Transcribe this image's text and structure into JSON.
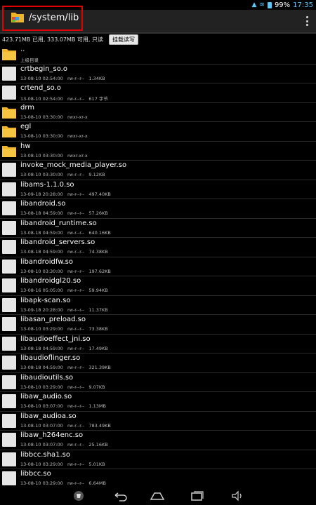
{
  "status": {
    "battery": "99%",
    "time": "17:35"
  },
  "header": {
    "path": "/system/lib"
  },
  "info": {
    "storage": "423.71MB 已用, 333.07MB 可用, 只读",
    "mount_button": "挂载读写"
  },
  "files": [
    {
      "type": "folder",
      "name": "..",
      "meta": "上级目录"
    },
    {
      "type": "file",
      "name": "crtbegin_so.o",
      "meta": "13-08-10 02:54:00   rw-r--r--   1.34KB"
    },
    {
      "type": "file",
      "name": "crtend_so.o",
      "meta": "13-08-10 02:54:00   rw-r--r--   617 字节"
    },
    {
      "type": "folder",
      "name": "drm",
      "meta": "13-08-10 03:30:00   rwxr-xr-x"
    },
    {
      "type": "folder",
      "name": "egl",
      "meta": "13-08-10 03:30:00   rwxr-xr-x"
    },
    {
      "type": "folder",
      "name": "hw",
      "meta": "13-08-10 03:30:00   rwxr-xr-x"
    },
    {
      "type": "file",
      "name": "invoke_mock_media_player.so",
      "meta": "13-08-10 03:30:00   rw-r--r--   9.12KB"
    },
    {
      "type": "file",
      "name": "libams-1.1.0.so",
      "meta": "13-09-18 20:28:00   rw-r--r--   497.40KB"
    },
    {
      "type": "file",
      "name": "libandroid.so",
      "meta": "13-08-18 04:59:00   rw-r--r--   57.26KB"
    },
    {
      "type": "file",
      "name": "libandroid_runtime.so",
      "meta": "13-08-18 04:59:00   rw-r--r--   640.16KB"
    },
    {
      "type": "file",
      "name": "libandroid_servers.so",
      "meta": "13-08-18 04:59:00   rw-r--r--   74.38KB"
    },
    {
      "type": "file",
      "name": "libandroidfw.so",
      "meta": "13-08-10 03:30:00   rw-r--r--   197.62KB"
    },
    {
      "type": "file",
      "name": "libandroidgl20.so",
      "meta": "13-08-16 05:05:00   rw-r--r--   59.94KB"
    },
    {
      "type": "file",
      "name": "libapk-scan.so",
      "meta": "13-09-18 20:28:00   rw-r--r--   11.37KB"
    },
    {
      "type": "file",
      "name": "libasan_preload.so",
      "meta": "13-08-10 03:29:00   rw-r--r--   73.38KB"
    },
    {
      "type": "file",
      "name": "libaudioeffect_jni.so",
      "meta": "13-08-18 04:59:00   rw-r--r--   17.49KB"
    },
    {
      "type": "file",
      "name": "libaudioflinger.so",
      "meta": "13-08-18 04:59:00   rw-r--r--   321.39KB"
    },
    {
      "type": "file",
      "name": "libaudioutils.so",
      "meta": "13-08-10 03:29:00   rw-r--r--   9.07KB"
    },
    {
      "type": "file",
      "name": "libaw_audio.so",
      "meta": "13-08-10 03:07:00   rw-r--r--   1.13MB"
    },
    {
      "type": "file",
      "name": "libaw_audioa.so",
      "meta": "13-08-10 03:07:00   rw-r--r--   783.49KB"
    },
    {
      "type": "file",
      "name": "libaw_h264enc.so",
      "meta": "13-08-10 03:07:00   rw-r--r--   25.16KB"
    },
    {
      "type": "file",
      "name": "libbcc.sha1.so",
      "meta": "13-08-10 03:29:00   rw-r--r--   5.01KB"
    },
    {
      "type": "file",
      "name": "libbcc.so",
      "meta": "13-08-10 03:29:00   rw-r--r--   6.64MB"
    }
  ],
  "colors": {
    "folder": "#f0b429",
    "highlight": "#e00000",
    "accent": "#5ac8ff"
  }
}
